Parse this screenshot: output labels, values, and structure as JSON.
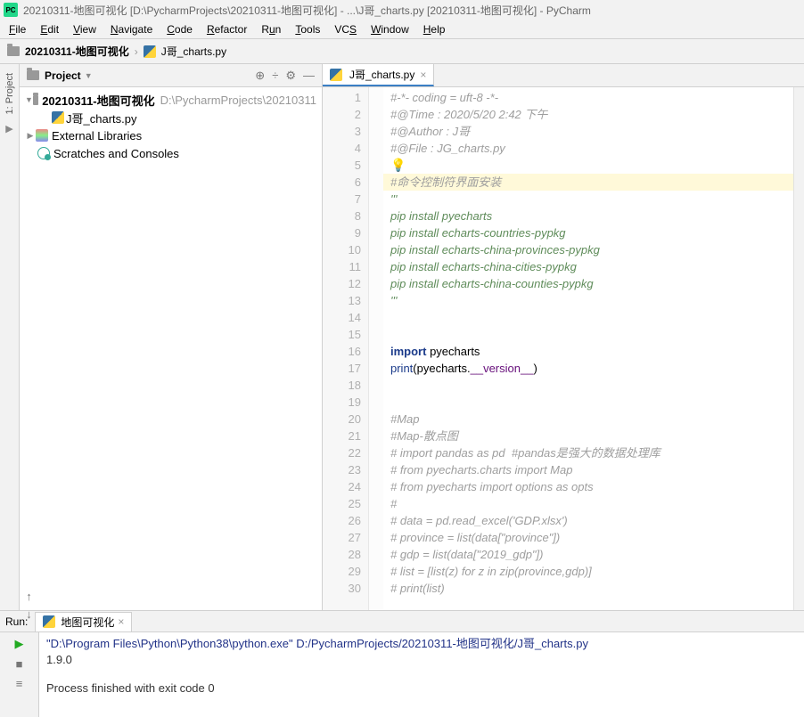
{
  "title": "20210311-地图可视化 [D:\\PycharmProjects\\20210311-地图可视化] - ...\\J哥_charts.py [20210311-地图可视化] - PyCharm",
  "menu": [
    "File",
    "Edit",
    "View",
    "Navigate",
    "Code",
    "Refactor",
    "Run",
    "Tools",
    "VCS",
    "Window",
    "Help"
  ],
  "nav": {
    "project": "20210311-地图可视化",
    "file": "J哥_charts.py"
  },
  "projPanel": {
    "title": "Project"
  },
  "leftGutter": {
    "project": "1: Project"
  },
  "tree": {
    "root": "20210311-地图可视化",
    "rootPath": "D:\\PycharmProjects\\20210311",
    "file": "J哥_charts.py",
    "ext": "External Libraries",
    "scratch": "Scratches and Consoles"
  },
  "tab": {
    "name": "J哥_charts.py"
  },
  "lines": [
    {
      "n": 1,
      "cls": "c-gray",
      "t": "#-*- coding = uft-8 -*-"
    },
    {
      "n": 2,
      "cls": "c-gray",
      "t": "#@Time : 2020/5/20 2:42 下午"
    },
    {
      "n": 3,
      "cls": "c-gray",
      "t": "#@Author : J哥"
    },
    {
      "n": 4,
      "cls": "c-gray",
      "t": "#@File : JG_charts.py"
    },
    {
      "n": 5,
      "cls": "bulb",
      "t": "💡"
    },
    {
      "n": 6,
      "cls": "c-gray hl",
      "t": "#命令控制符界面安装"
    },
    {
      "n": 7,
      "cls": "c-str",
      "t": "'''"
    },
    {
      "n": 8,
      "cls": "c-str",
      "t": "pip install pyecharts"
    },
    {
      "n": 9,
      "cls": "c-str",
      "t": "pip install echarts-countries-pypkg"
    },
    {
      "n": 10,
      "cls": "c-str",
      "t": "pip install echarts-china-provinces-pypkg"
    },
    {
      "n": 11,
      "cls": "c-str",
      "t": "pip install echarts-china-cities-pypkg"
    },
    {
      "n": 12,
      "cls": "c-str",
      "t": "pip install echarts-china-counties-pypkg"
    },
    {
      "n": 13,
      "cls": "c-str",
      "t": "'''"
    },
    {
      "n": 14,
      "cls": "",
      "t": " "
    },
    {
      "n": 15,
      "cls": "",
      "t": " "
    },
    {
      "n": 16,
      "cls": "",
      "html": "<span class='c-kw'>import</span> pyecharts"
    },
    {
      "n": 17,
      "cls": "",
      "html": "<span class='c-bi'>print</span>(pyecharts.<span class='c-dund'>__version__</span>)"
    },
    {
      "n": 18,
      "cls": "",
      "t": " "
    },
    {
      "n": 19,
      "cls": "",
      "t": " "
    },
    {
      "n": 20,
      "cls": "c-gray",
      "t": "#Map"
    },
    {
      "n": 21,
      "cls": "c-gray",
      "t": "#Map-散点图"
    },
    {
      "n": 22,
      "cls": "c-gray",
      "t": "# import pandas as pd  #pandas是强大的数据处理库"
    },
    {
      "n": 23,
      "cls": "c-gray",
      "t": "# from pyecharts.charts import Map"
    },
    {
      "n": 24,
      "cls": "c-gray",
      "t": "# from pyecharts import options as opts"
    },
    {
      "n": 25,
      "cls": "c-gray",
      "t": "#"
    },
    {
      "n": 26,
      "cls": "c-gray",
      "t": "# data = pd.read_excel('GDP.xlsx')"
    },
    {
      "n": 27,
      "cls": "c-gray",
      "t": "# province = list(data[\"province\"])"
    },
    {
      "n": 28,
      "cls": "c-gray",
      "t": "# gdp = list(data[\"2019_gdp\"])"
    },
    {
      "n": 29,
      "cls": "c-gray",
      "t": "# list = [list(z) for z in zip(province,gdp)]"
    },
    {
      "n": 30,
      "cls": "c-gray",
      "t": "# print(list)"
    }
  ],
  "run": {
    "label": "Run:",
    "tab": "地图可视化",
    "cmd": "\"D:\\Program Files\\Python\\Python38\\python.exe\" D:/PycharmProjects/20210311-地图可视化/J哥_charts.py",
    "out": "1.9.0",
    "exit": "Process finished with exit code 0"
  }
}
